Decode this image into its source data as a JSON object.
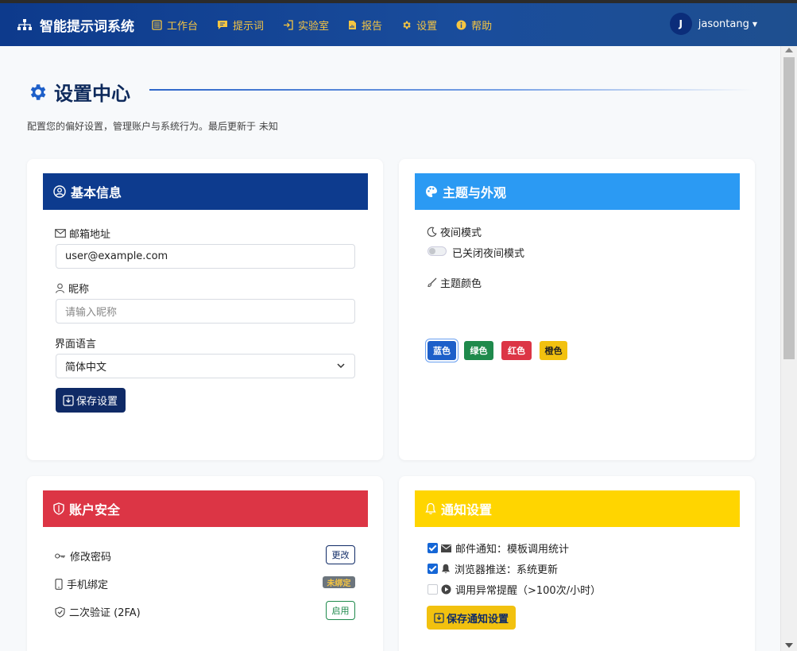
{
  "brand": {
    "name": "智能提示词系统"
  },
  "nav": [
    {
      "label": "工作台"
    },
    {
      "label": "提示词"
    },
    {
      "label": "实验室"
    },
    {
      "label": "报告"
    },
    {
      "label": "设置"
    },
    {
      "label": "帮助"
    }
  ],
  "user": {
    "initial": "J",
    "name": "jasontang"
  },
  "page": {
    "title": "设置中心",
    "subtitle": "配置您的偏好设置，管理账户与系统行为。最后更新于 未知"
  },
  "basic": {
    "title": "基本信息",
    "email_label": "邮箱地址",
    "email_value": "user@example.com",
    "nickname_label": "昵称",
    "nickname_placeholder": "请输入昵称",
    "language_label": "界面语言",
    "language_value": "简体中文",
    "save_label": "保存设置"
  },
  "theme": {
    "title": "主题与外观",
    "night_label": "夜间模式",
    "night_status": "已关闭夜间模式",
    "color_label": "主题颜色",
    "colors": [
      {
        "label": "蓝色",
        "color": "#1d5fc9"
      },
      {
        "label": "绿色",
        "color": "#1f8a4c"
      },
      {
        "label": "红色",
        "color": "#dc3545"
      },
      {
        "label": "橙色",
        "color": "#f2c10f"
      }
    ]
  },
  "security": {
    "title": "账户安全",
    "rows": [
      {
        "label": "修改密码",
        "action": "更改"
      },
      {
        "label": "手机绑定",
        "action": "未绑定"
      },
      {
        "label": "二次验证 (2FA)",
        "action": "启用"
      }
    ]
  },
  "notify": {
    "title": "通知设置",
    "items": [
      {
        "label": "邮件通知：模板调用统计",
        "checked": true
      },
      {
        "label": "浏览器推送：系统更新",
        "checked": true
      },
      {
        "label": "调用异常提醒（>100次/小时）",
        "checked": false
      }
    ],
    "save_label": "保存通知设置"
  },
  "colors": {
    "navbar": "#0d3a8c",
    "basic_header": "#0d3b8e",
    "theme_header": "#2b9af3",
    "security_header": "#dc3545",
    "notify_header": "#ffd500",
    "accent_yellow": "#f5c542"
  }
}
